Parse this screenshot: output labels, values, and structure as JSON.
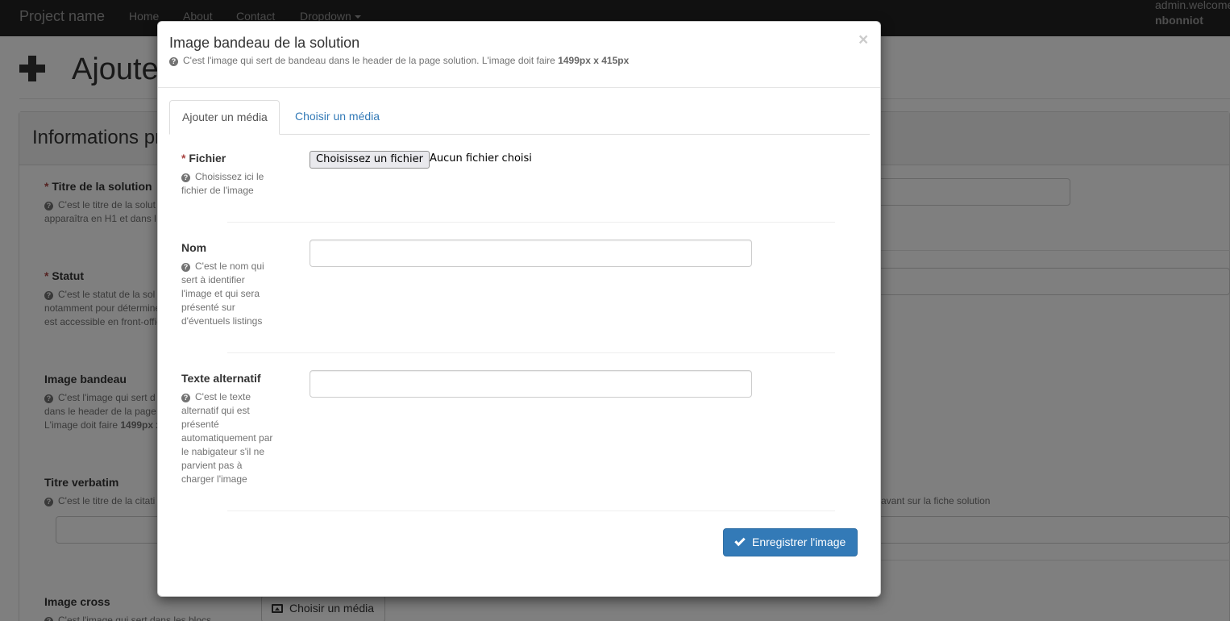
{
  "navbar": {
    "brand": "Project name",
    "links": [
      "Home",
      "About",
      "Contact",
      "Dropdown"
    ],
    "user_welcome": "admin.welcome",
    "user_name": "nbonniot"
  },
  "background": {
    "page_title": "Ajouter",
    "panel_heading": "Informations pr",
    "fields": [
      {
        "label": "Titre de la solution",
        "required": "*",
        "help": [
          "C'est le titre de la solut",
          "apparaîtra en H1 et dans l"
        ]
      },
      {
        "label": "Statut",
        "required": "*",
        "help": [
          "C'est le statut de la sol",
          "notamment pour détermine",
          "est accessible en front-offic"
        ]
      },
      {
        "label": "Image bandeau",
        "help": [
          "C'est l'image qui sert d",
          "dans le header de la page",
          "L'image doit faire"
        ],
        "help_bold": "1499px x"
      },
      {
        "label": "Titre verbatim",
        "help": [
          "C'est le titre de la citati"
        ],
        "help_right": "avant sur la fiche solution"
      },
      {
        "label": "Image cross",
        "help": [
          "C'est l'image qui sert dans les blocs"
        ]
      }
    ],
    "choose_media_button": "Choisir un média"
  },
  "modal": {
    "title": "Image bandeau de la solution",
    "subtitle": "C'est l'image qui sert de bandeau dans le header de la page solution. L'image doit faire",
    "subtitle_bold": "1499px x 415px",
    "close": "×",
    "tabs": [
      {
        "label": "Ajouter un média",
        "active": true
      },
      {
        "label": "Choisir un média",
        "active": false
      }
    ],
    "file": {
      "required": "*",
      "label": "Fichier",
      "help": "Choisissez ici le fichier de l'image",
      "button": "Choisissez un fichier",
      "status": "Aucun fichier choisi"
    },
    "name": {
      "label": "Nom",
      "help": "C'est le nom qui sert à identifier l'image et qui sera présenté sur d'éventuels listings",
      "value": ""
    },
    "alt": {
      "label": "Texte alternatif",
      "help": "C'est le texte alternatif qui est présenté automatiquement par le nabigateur s'il ne parvient pas à charger l'image",
      "value": ""
    },
    "save_button": "Enregistrer l'image"
  },
  "colors": {
    "primary": "#337ab7",
    "navbar": "#222222",
    "required": "#a94442",
    "help_text": "#737373"
  }
}
